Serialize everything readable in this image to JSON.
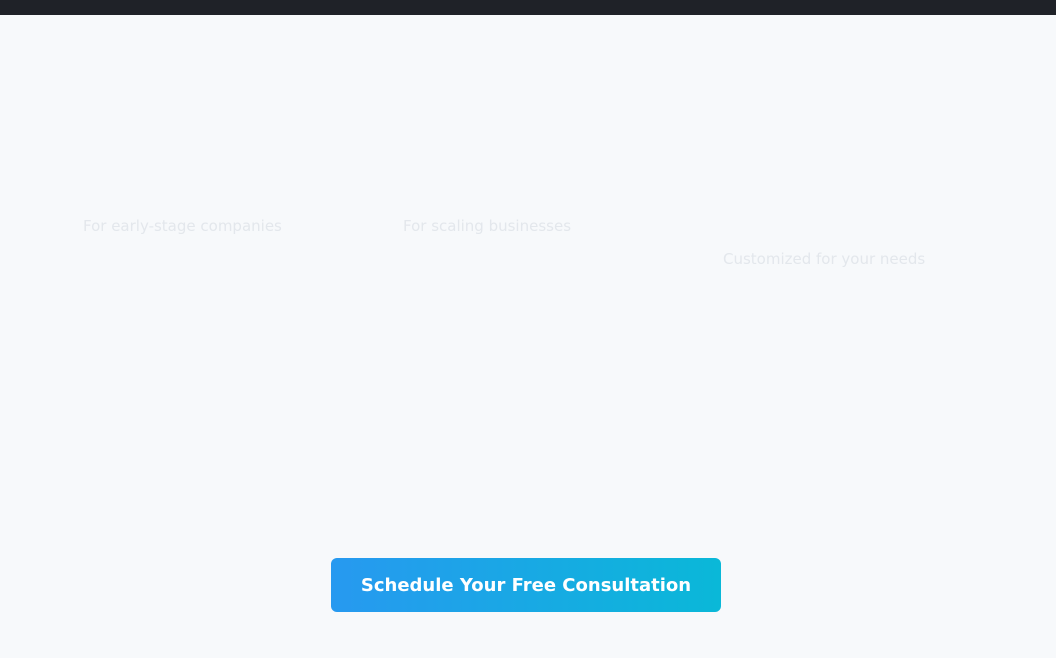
{
  "pricing": {
    "tiers": [
      {
        "subtitle": "For early-stage companies"
      },
      {
        "subtitle": "For scaling businesses"
      },
      {
        "subtitle": "Customized for your needs"
      }
    ]
  },
  "cta": {
    "label": "Schedule Your Free Consultation"
  },
  "colors": {
    "topbar": "#1f2228",
    "background": "#f7f9fb",
    "cta_gradient_start": "#2799f0",
    "cta_gradient_end": "#0ab8d8"
  }
}
